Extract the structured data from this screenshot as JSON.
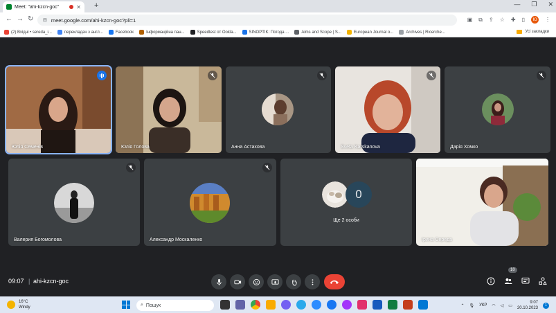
{
  "browser": {
    "tab_title": "Meet: \"ahi-kzcn-goc\"",
    "url": "meet.google.com/ahi-kzcn-goc?pli=1",
    "profile_initial": "Ю",
    "bookmarks": [
      {
        "label": "(2) Вхідні • sereda_i...",
        "color": "#ea4335"
      },
      {
        "label": "перекладач з англ...",
        "color": "#4285f4"
      },
      {
        "label": "Facebook",
        "color": "#1877f2"
      },
      {
        "label": "Інформаційна пан...",
        "color": "#b06000"
      },
      {
        "label": "Speedtest от Ookla...",
        "color": "#202124"
      },
      {
        "label": "SINOPTIK: Погода ...",
        "color": "#1a73e8"
      },
      {
        "label": "Aims and Scope | S...",
        "color": "#5f6368"
      },
      {
        "label": "European Journal o...",
        "color": "#f4b400"
      },
      {
        "label": "Archives | Ricerche...",
        "color": "#9aa0a6"
      }
    ],
    "bookmarks_folder": "Усі закладки"
  },
  "participants": [
    {
      "name": "Юлія Семенів",
      "state": "speaking"
    },
    {
      "name": "Юлія Голова",
      "state": "muted"
    },
    {
      "name": "Анна Астахова",
      "state": "muted"
    },
    {
      "name": "Sveta Karskanova",
      "state": "muted"
    },
    {
      "name": "Дарія Хомко",
      "state": "muted"
    },
    {
      "name": "Валерия Богомолова",
      "state": "muted"
    },
    {
      "name": "Александр Москаленко",
      "state": "muted"
    },
    {
      "name": "Ірина Середа",
      "state": "camera"
    }
  ],
  "others": {
    "count": "0",
    "label": "Ще 2 особи"
  },
  "meeting": {
    "time": "09:07",
    "separator": "|",
    "code": "ahi-kzcn-goc",
    "people_badge": "10"
  },
  "taskbar": {
    "temp": "16°C",
    "weather": "Windy",
    "search_label": "Пошук",
    "lang": "УКР",
    "time": "9:07",
    "date": "20.10.2023",
    "notif": "1"
  },
  "colors": {
    "hangup": "#ea4335",
    "speaking": "#1a73e8",
    "tile_bg": "#3c4043"
  }
}
